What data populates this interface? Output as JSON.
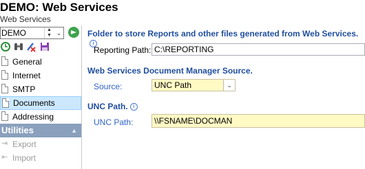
{
  "header": {
    "title": "DEMO: Web Services",
    "subtitle": "Web Services"
  },
  "sidebar": {
    "company": "DEMO",
    "toolbar_icons": [
      "history-icon",
      "binoculars-icon",
      "edit-delete-icon",
      "save-icon"
    ],
    "items": [
      {
        "label": "General"
      },
      {
        "label": "Internet"
      },
      {
        "label": "SMTP"
      },
      {
        "label": "Documents"
      },
      {
        "label": "Addressing"
      }
    ],
    "utilities": {
      "header": "Utilities",
      "items": [
        {
          "label": "Export"
        },
        {
          "label": "Import"
        }
      ]
    }
  },
  "main": {
    "folder_section": {
      "title": "Folder to store Reports and other files generated from Web Services.",
      "reporting_path_label": "Reporting Path:",
      "reporting_path_value": "C:\\REPORTING"
    },
    "docman_section": {
      "title": "Web Services Document Manager Source.",
      "source_label": "Source:",
      "source_value": "UNC Path"
    },
    "unc_section": {
      "title": "UNC Path.",
      "unc_path_label": "UNC Path:",
      "unc_path_value": "\\\\FSNAME\\DOCMAN"
    }
  },
  "colors": {
    "accent_blue": "#1f4e9e",
    "label_blue": "#2f63c7",
    "selected_bg": "#cce8ff",
    "section_header": "#8aa0bd",
    "field_highlight": "#fff9c4"
  }
}
